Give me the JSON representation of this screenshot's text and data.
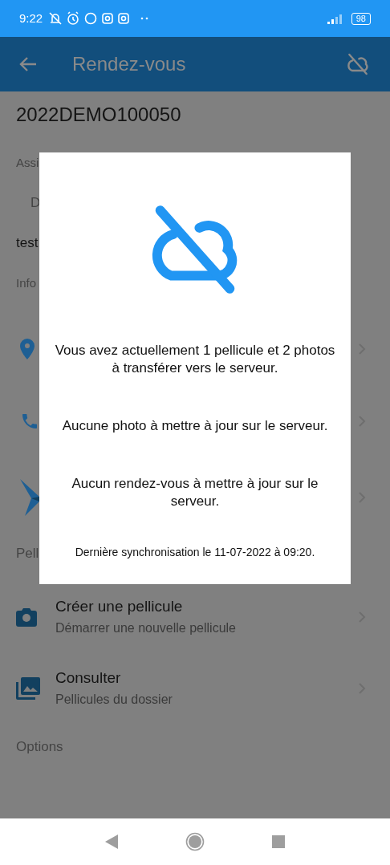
{
  "status_bar": {
    "time": "9:22",
    "battery": "98"
  },
  "app_bar": {
    "title": "Rendez-vous"
  },
  "record": {
    "title": "2022DEMO100050"
  },
  "background_fragments": [
    {
      "kind": "label",
      "text": "Assi"
    },
    {
      "kind": "indented",
      "text": "D"
    },
    {
      "kind": "value",
      "text": "test"
    },
    {
      "kind": "label",
      "text": "Info"
    }
  ],
  "info_rows": [
    {
      "kind": "pin"
    },
    {
      "kind": "phone"
    },
    {
      "kind": "logo"
    }
  ],
  "section_fragment": "Pell",
  "film_rows": [
    {
      "kind": "camera",
      "title": "Créer une pellicule",
      "subtitle": "Démarrer une nouvelle pellicule"
    },
    {
      "kind": "photos",
      "title": "Consulter",
      "subtitle": "Pellicules du dossier"
    }
  ],
  "options_header": "Options",
  "dialog": {
    "messages": [
      "Vous avez actuellement 1 pellicule et 2 photos à transférer vers le serveur.",
      "Aucune photo à mettre à jour sur le serveur.",
      "Aucun rendez-vous à mettre à jour sur le serveur."
    ],
    "footer": "Dernière synchronisation le 11-07-2022 à 09:20."
  }
}
